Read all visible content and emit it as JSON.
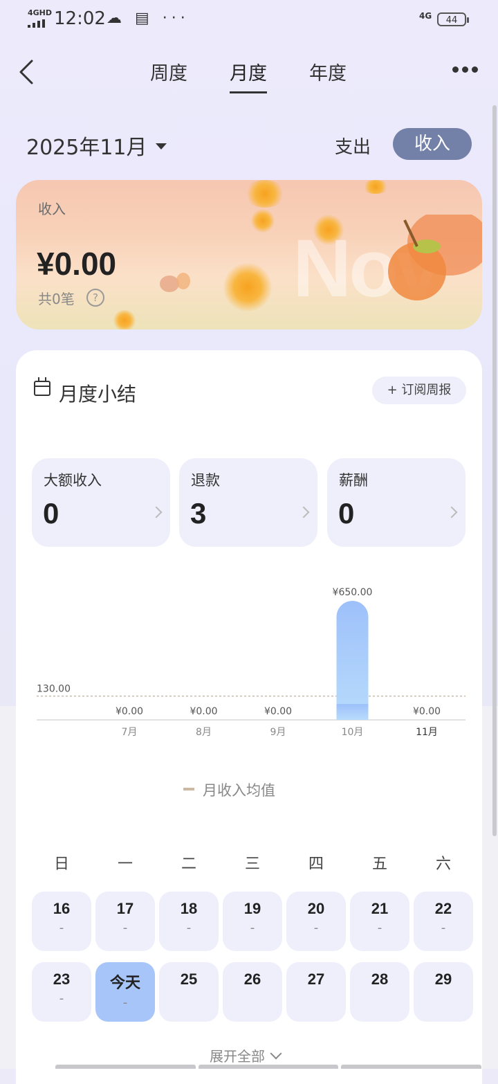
{
  "status_bar": {
    "network_label": "4GHD",
    "time": "12:02",
    "right_network": "4G",
    "battery": "44"
  },
  "header": {
    "tabs": [
      {
        "label": "周度",
        "active": false
      },
      {
        "label": "月度",
        "active": true
      },
      {
        "label": "年度",
        "active": false
      }
    ]
  },
  "selector": {
    "month": "2025年11月",
    "expense_label": "支出",
    "income_label": "收入"
  },
  "hero": {
    "label": "收入",
    "amount": "¥0.00",
    "count": "共0笔",
    "watermark": "Nov"
  },
  "summary": {
    "title": "月度小结",
    "subscribe": "+ 订阅周报",
    "stats": [
      {
        "label": "大额收入",
        "value": "0"
      },
      {
        "label": "退款",
        "value": "3"
      },
      {
        "label": "薪酬",
        "value": "0"
      }
    ]
  },
  "chart_data": {
    "type": "bar",
    "categories": [
      "7月",
      "8月",
      "9月",
      "10月",
      "11月"
    ],
    "values": [
      0,
      0,
      0,
      650,
      0
    ],
    "value_labels": [
      "¥0.00",
      "¥0.00",
      "¥0.00",
      "¥650.00",
      "¥0.00"
    ],
    "average": 130,
    "average_label": "130.00",
    "legend": "月收入均值",
    "bar_color": "#a6c6fb",
    "avg_line_color": "#cbb9a3"
  },
  "calendar": {
    "weekdays": [
      "日",
      "一",
      "二",
      "三",
      "四",
      "五",
      "六"
    ],
    "week1": [
      {
        "num": "16",
        "amt": "-"
      },
      {
        "num": "17",
        "amt": "-"
      },
      {
        "num": "18",
        "amt": "-"
      },
      {
        "num": "19",
        "amt": "-"
      },
      {
        "num": "20",
        "amt": "-"
      },
      {
        "num": "21",
        "amt": "-"
      },
      {
        "num": "22",
        "amt": "-"
      }
    ],
    "week2": [
      {
        "num": "23",
        "amt": "-"
      },
      {
        "num": "今天",
        "amt": "-"
      },
      {
        "num": "25",
        "amt": ""
      },
      {
        "num": "26",
        "amt": ""
      },
      {
        "num": "27",
        "amt": ""
      },
      {
        "num": "28",
        "amt": ""
      },
      {
        "num": "29",
        "amt": ""
      }
    ],
    "expand": "展开全部"
  }
}
